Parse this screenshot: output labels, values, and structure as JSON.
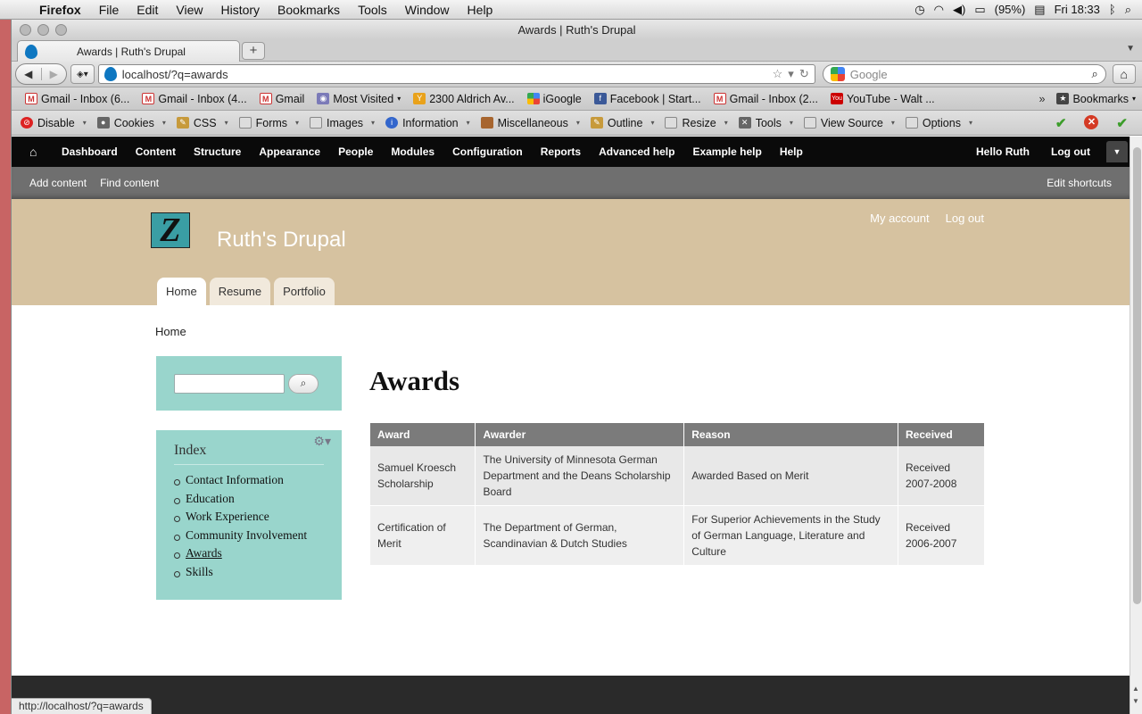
{
  "os_menubar": {
    "app": "Firefox",
    "menus": [
      "File",
      "Edit",
      "View",
      "History",
      "Bookmarks",
      "Tools",
      "Window",
      "Help"
    ],
    "battery": "(95%)",
    "clock": "Fri 18:33"
  },
  "window": {
    "title": "Awards | Ruth's Drupal"
  },
  "tab": {
    "label": "Awards | Ruth's Drupal",
    "new_tab": "+"
  },
  "navbar": {
    "url": "localhost/?q=awards",
    "search_placeholder": "Google"
  },
  "bookmarks": {
    "items": [
      {
        "label": "Gmail - Inbox (6...",
        "icon": "gmail-icon"
      },
      {
        "label": "Gmail - Inbox (4...",
        "icon": "gmail-icon"
      },
      {
        "label": "Gmail",
        "icon": "gmail-icon"
      },
      {
        "label": "Most Visited",
        "icon": "most-visited-icon"
      },
      {
        "label": "2300 Aldrich Av...",
        "icon": "yahoo-maps-icon"
      },
      {
        "label": "iGoogle",
        "icon": "igoogle-icon"
      },
      {
        "label": "Facebook | Start...",
        "icon": "facebook-icon"
      },
      {
        "label": "Gmail - Inbox (2...",
        "icon": "gmail-icon"
      },
      {
        "label": "YouTube - Walt ...",
        "icon": "youtube-icon"
      }
    ],
    "more": "»",
    "bookmarks_menu": "Bookmarks"
  },
  "webdev_toolbar": {
    "items": [
      "Disable",
      "Cookies",
      "CSS",
      "Forms",
      "Images",
      "Information",
      "Miscellaneous",
      "Outline",
      "Resize",
      "Tools",
      "View Source",
      "Options"
    ]
  },
  "admin_toolbar": {
    "items": [
      "Dashboard",
      "Content",
      "Structure",
      "Appearance",
      "People",
      "Modules",
      "Configuration",
      "Reports",
      "Advanced help",
      "Example help",
      "Help"
    ],
    "greeting": "Hello Ruth",
    "logout": "Log out"
  },
  "shortcuts": {
    "add_content": "Add content",
    "find_content": "Find content",
    "edit": "Edit shortcuts"
  },
  "site": {
    "name": "Ruth's Drupal",
    "logo_letter": "Z",
    "my_account": "My account",
    "log_out": "Log out",
    "main_menu": [
      "Home",
      "Resume",
      "Portfolio"
    ]
  },
  "breadcrumb": "Home",
  "sidebar": {
    "index_title": "Index",
    "index_items": [
      "Contact Information",
      "Education",
      "Work Experience",
      "Community Involvement",
      "Awards",
      "Skills"
    ],
    "current": "Awards"
  },
  "content": {
    "title": "Awards",
    "table": {
      "headers": [
        "Award",
        "Awarder",
        "Reason",
        "Received"
      ],
      "rows": [
        [
          "Samuel Kroesch Scholarship",
          "The University of Minnesota German Department and the Deans Scholarship Board",
          "Awarded Based on Merit",
          "Received 2007-2008"
        ],
        [
          "Certification of Merit",
          "The Department of German, Scandinavian & Dutch Studies",
          "For Superior Achievements in the Study of German Language, Literature and Culture",
          "Received 2006-2007"
        ]
      ]
    }
  },
  "status_bar": "http://localhost/?q=awards"
}
